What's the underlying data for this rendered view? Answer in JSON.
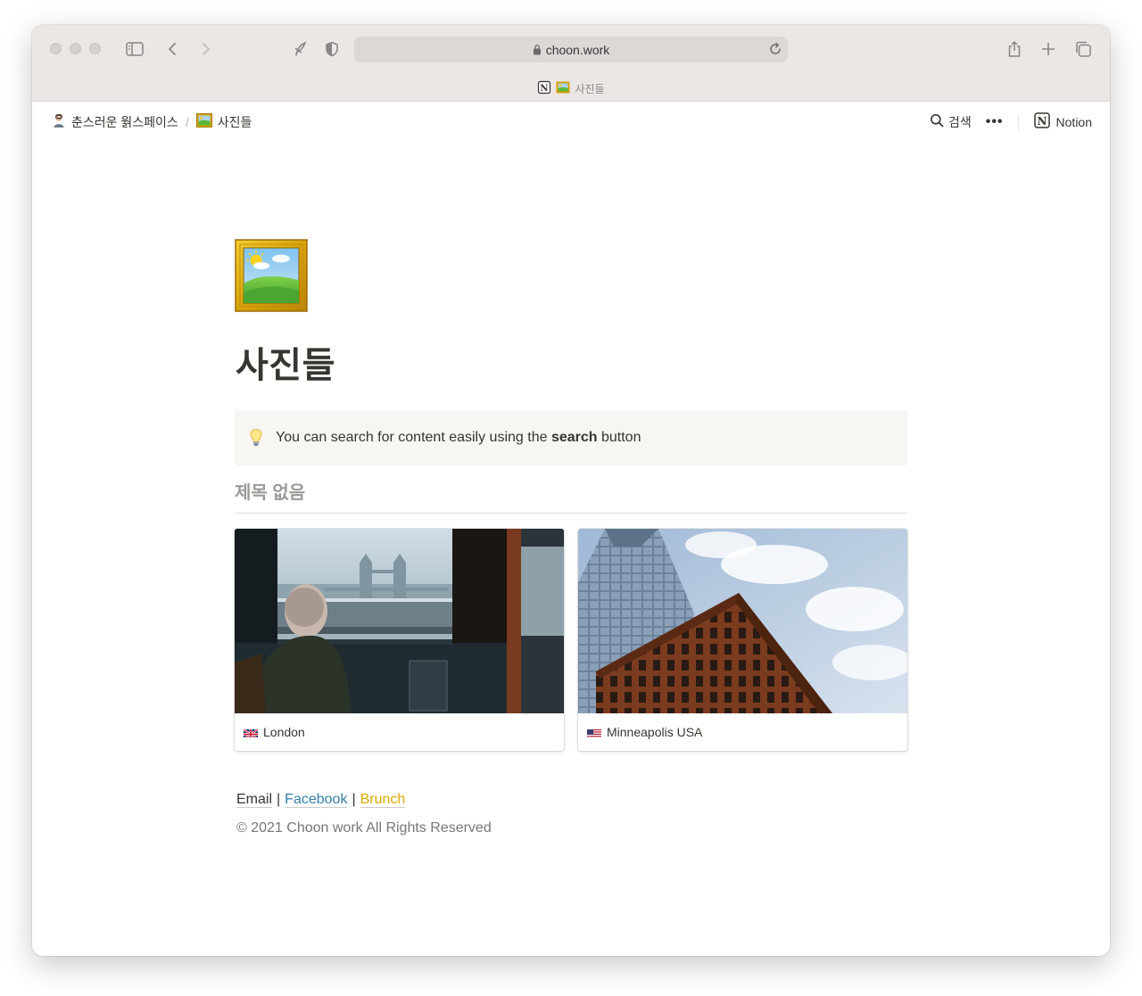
{
  "browser": {
    "url": "choon.work",
    "tab_title": "사진들"
  },
  "topbar": {
    "workspace": "춘스러운 웕스페이스",
    "separator": "/",
    "page": "사진들",
    "search_label": "검색",
    "more_label": "•••",
    "notion_label": "Notion"
  },
  "page": {
    "title": "사진들",
    "callout": {
      "prefix": "You can search for content easily using the ",
      "bold": "search",
      "suffix": " button"
    },
    "database_title": "제목 없음",
    "cards": [
      {
        "label": "London",
        "flag": "uk-flag"
      },
      {
        "label": "Minneapolis USA",
        "flag": "us-flag"
      }
    ]
  },
  "footer": {
    "email": "Email",
    "facebook": "Facebook",
    "brunch": "Brunch",
    "separator": "|",
    "copyright": "© 2021 Choon work All Rights Reserved"
  },
  "colors": {
    "chrome_bg": "#ece6e5",
    "text": "#37352f",
    "muted": "#9b9a97",
    "facebook": "#337ea9",
    "brunch": "#dfab01",
    "callout_bg": "#f7f6f3"
  }
}
